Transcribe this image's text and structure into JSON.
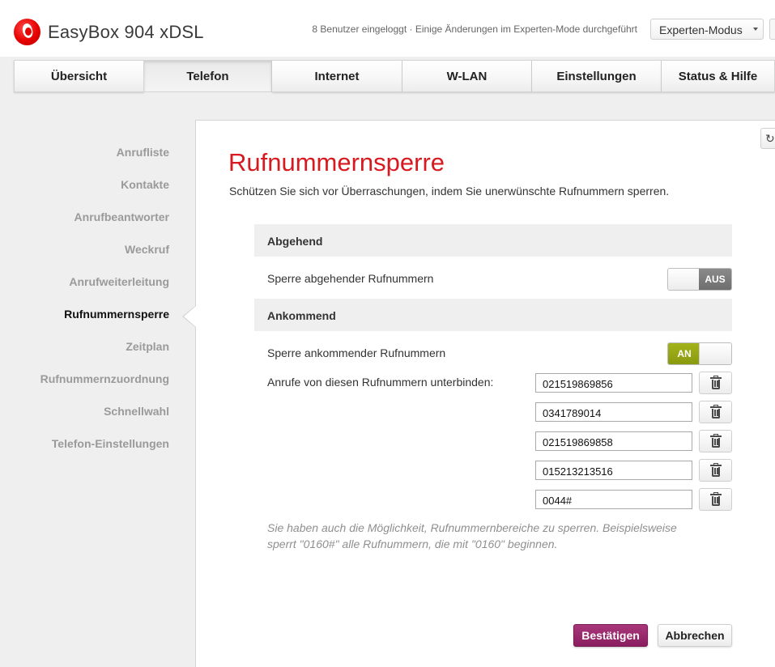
{
  "header": {
    "app_title": "EasyBox 904 xDSL",
    "status_text": "8 Benutzer eingeloggt · Einige Änderungen im Experten-Mode durchgeführt",
    "mode_select": {
      "value": "Experten-Modus"
    }
  },
  "nav": {
    "tabs": [
      {
        "label": "Übersicht",
        "active": false
      },
      {
        "label": "Telefon",
        "active": true
      },
      {
        "label": "Internet",
        "active": false
      },
      {
        "label": "W-LAN",
        "active": false
      },
      {
        "label": "Einstellungen",
        "active": false
      },
      {
        "label": "Status & Hilfe",
        "active": false
      }
    ]
  },
  "sidebar": {
    "items": [
      {
        "label": "Anrufliste",
        "active": false
      },
      {
        "label": "Kontakte",
        "active": false
      },
      {
        "label": "Anrufbeantworter",
        "active": false
      },
      {
        "label": "Weckruf",
        "active": false
      },
      {
        "label": "Anrufweiterleitung",
        "active": false
      },
      {
        "label": "Rufnummernsperre",
        "active": true
      },
      {
        "label": "Zeitplan",
        "active": false
      },
      {
        "label": "Rufnummernzuordnung",
        "active": false
      },
      {
        "label": "Schnellwahl",
        "active": false
      },
      {
        "label": "Telefon-Einstellungen",
        "active": false
      }
    ]
  },
  "main": {
    "title": "Rufnummernsperre",
    "subtitle": "Schützen Sie sich vor Überraschungen, indem Sie unerwünschte Rufnummern sperren.",
    "outgoing": {
      "section_title": "Abgehend",
      "toggle_label": "Sperre abgehender Rufnummern",
      "toggle_state": "AUS"
    },
    "incoming": {
      "section_title": "Ankommend",
      "toggle_label": "Sperre ankommender Rufnummern",
      "toggle_state": "AN",
      "list_label": "Anrufe von diesen Rufnummern unterbinden:",
      "numbers": [
        "021519869856",
        "0341789014",
        "021519869858",
        "015213213516",
        "0044#"
      ]
    },
    "hint": "Sie haben auch die Möglichkeit, Rufnummernbereiche zu sperren. Beispielsweise sperrt \"0160#\" alle Rufnummern, die mit \"0160\" beginnen.",
    "buttons": {
      "confirm": "Bestätigen",
      "cancel": "Abbrechen"
    }
  },
  "colors": {
    "brand_red": "#e60000",
    "title_red": "#d71920",
    "confirm_purple": "#8a1e60",
    "toggle_on_green": "#8a9a0f",
    "toggle_off_gray": "#6e6e6e"
  },
  "icons": [
    "vodafone-logo",
    "refresh-icon",
    "trash-icon",
    "chevron-down-icon"
  ]
}
